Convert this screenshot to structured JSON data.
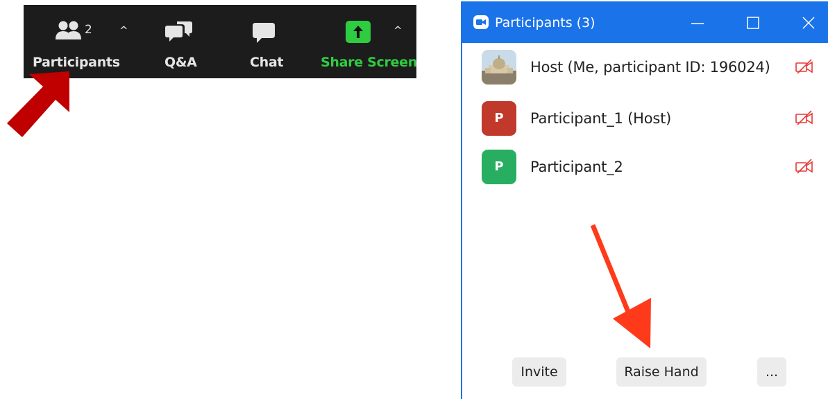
{
  "toolbar": {
    "participants": {
      "label": "Participants",
      "count": "2"
    },
    "qa": {
      "label": "Q&A"
    },
    "chat": {
      "label": "Chat"
    },
    "share": {
      "label": "Share Screen",
      "color": "#2ecc40"
    },
    "caret_glyph": "^",
    "background": "#1c1c1c"
  },
  "window": {
    "title": "Participants (3)",
    "accent": "#1a73e8",
    "participants": [
      {
        "name": "Host (Me, participant ID: 196024)",
        "avatar_letter": "",
        "avatar": "photo",
        "video": "off"
      },
      {
        "name": "Participant_1 (Host)",
        "avatar_letter": "P",
        "avatar_color": "#c0392b",
        "video": "off"
      },
      {
        "name": "Participant_2",
        "avatar_letter": "P",
        "avatar_color": "#27ae60",
        "video": "off"
      }
    ],
    "buttons": {
      "invite": "Invite",
      "raise_hand": "Raise Hand",
      "more": "..."
    }
  },
  "icons": {
    "participants": "people-icon",
    "qa": "qa-bubbles-icon",
    "chat": "chat-bubble-icon",
    "share": "share-up-arrow-icon",
    "video_off": "video-off-icon",
    "zoom_logo": "camera-logo-icon",
    "minimize": "minimize-icon",
    "maximize": "maximize-icon",
    "close": "close-icon"
  },
  "annotations": {
    "arrow_color_left": "#c00000",
    "arrow_color_right": "#ff3a1a"
  }
}
